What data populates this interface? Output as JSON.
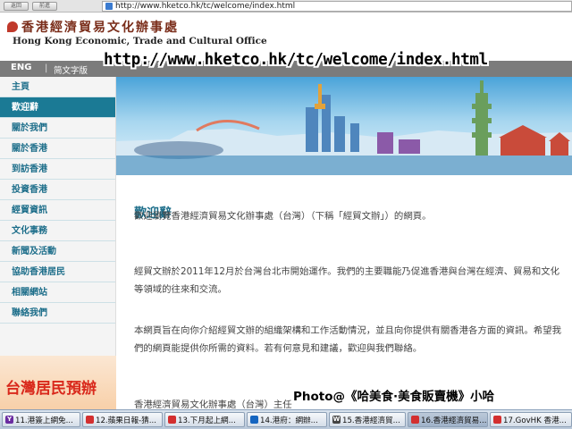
{
  "browser": {
    "back_label": "返回",
    "forward_label": "前進",
    "address": "http://www.hketco.hk/tc/welcome/index.html"
  },
  "header": {
    "logo_zh": "香港經濟貿易文化辦事處",
    "logo_en": "Hong Kong Economic, Trade and Cultural Office"
  },
  "lang_bar": {
    "eng": "ENG",
    "separator": "|",
    "simplified": "简文字版"
  },
  "url_overlay": "http://www.hketco.hk/tc/welcome/index.html",
  "sidebar": {
    "items": [
      {
        "label": "主頁",
        "active": false
      },
      {
        "label": "歡迎辭",
        "active": true
      },
      {
        "label": "關於我們",
        "active": false
      },
      {
        "label": "關於香港",
        "active": false
      },
      {
        "label": "到訪香港",
        "active": false
      },
      {
        "label": "投資香港",
        "active": false
      },
      {
        "label": "經貿資訊",
        "active": false
      },
      {
        "label": "文化事務",
        "active": false
      },
      {
        "label": "新聞及活動",
        "active": false
      },
      {
        "label": "協助香港居民",
        "active": false
      },
      {
        "label": "相關網站",
        "active": false
      },
      {
        "label": "聯絡我們",
        "active": false
      }
    ],
    "promo": "台灣居民預辦"
  },
  "main": {
    "title": "歡迎辭",
    "paragraphs": [
      "歡迎瀏覽香港經濟貿易文化辦事處（台灣）（下稱「經貿文辦」）的網頁。",
      "經貿文辦於2011年12月於台灣台北市開始運作。我們的主要職能乃促進香港與台灣在經濟、貿易和文化等領域的往來和交流。",
      "本網頁旨在向你介紹經貿文辦的組織架構和工作活動情況，並且向你提供有關香港各方面的資訊。希望我們的網頁能提供你所需的資料。若有何意見和建議，歡迎與我們聯絡。"
    ],
    "signature": "香港經濟貿易文化辦事處（台灣）主任"
  },
  "watermark": "Photo@《哈美食·美食販賣機》小哈",
  "taskbar": {
    "tasks": [
      {
        "label": "11.港簽上網免...",
        "icon_color": "#6a2ca0",
        "icon": "Y",
        "active": false
      },
      {
        "label": "12.蘋果日報-猜...",
        "icon_color": "#d32f2f",
        "icon": "",
        "active": false
      },
      {
        "label": "13.下月起上網...",
        "icon_color": "#d32f2f",
        "icon": "",
        "active": false
      },
      {
        "label": "14.港府：網辦...",
        "icon_color": "#1565c0",
        "icon": "",
        "active": false
      },
      {
        "label": "15.香港經濟貿...",
        "icon_color": "#444444",
        "icon": "W",
        "active": false
      },
      {
        "label": "16.香港經濟貿易...",
        "icon_color": "#d32f2f",
        "icon": "",
        "active": true
      },
      {
        "label": "17.GovHK 香港...",
        "icon_color": "#d32f2f",
        "icon": "",
        "active": false
      }
    ]
  },
  "colors": {
    "accent": "#1b7a95",
    "sidebar_text": "#1d6e8a",
    "lang_bar": "#7b7b7b",
    "promo_text": "#d9291c"
  }
}
